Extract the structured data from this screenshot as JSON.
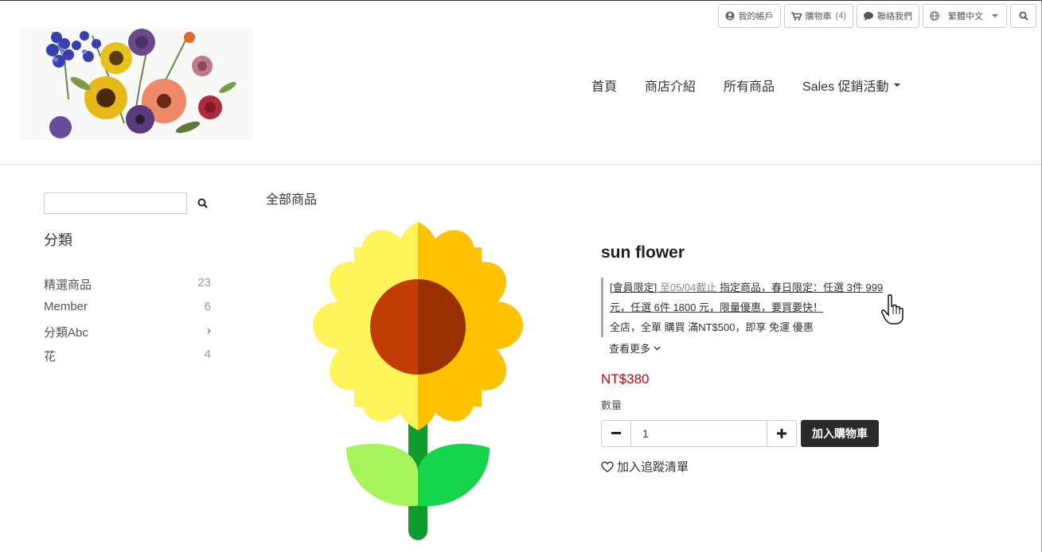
{
  "topbar": {
    "account": "我的帳戶",
    "cart": "購物車",
    "cart_count": "(4)",
    "contact": "聯絡我們",
    "language": "繁體中文"
  },
  "nav": {
    "home": "首頁",
    "about": "商店介紹",
    "all_products": "所有商品",
    "sales": "Sales 促銷活動"
  },
  "sidebar": {
    "search_placeholder": "",
    "category_title": "分類",
    "categories": [
      {
        "label": "精選商品",
        "count": "23"
      },
      {
        "label": "Member",
        "count": "6"
      },
      {
        "label": "分類Abc",
        "count": "›"
      },
      {
        "label": "花",
        "count": "4"
      }
    ]
  },
  "breadcrumb": "全部商品",
  "product": {
    "title": "sun flower",
    "promo_tag": "[會員限定]",
    "promo_deadline": "至05/04截止",
    "promo_line1_rest": "指定商品，春日限定：任選 3件 999",
    "promo_line2": "元，任選 6件 1800 元，限量優惠，要買要快！",
    "promo_line3": "全店，全單 購買 滿NT$500，即享 免運 優惠",
    "see_more": "查看更多",
    "price": "NT$380",
    "qty_label": "數量",
    "qty_value": "1",
    "add_to_cart": "加入購物車",
    "wishlist": "加入追蹤清單"
  }
}
